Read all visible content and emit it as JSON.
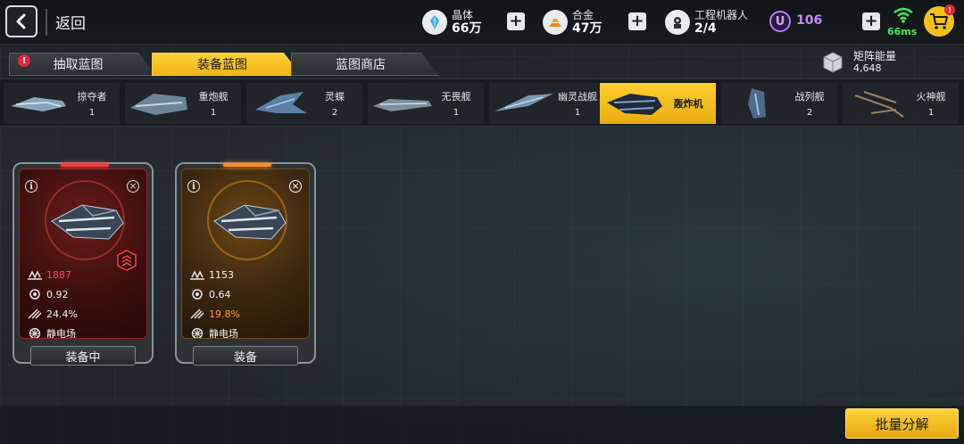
{
  "header": {
    "back_label": "返回",
    "resources": [
      {
        "label": "晶体",
        "value": "66万",
        "icon": "crystal-icon"
      },
      {
        "label": "合金",
        "value": "47万",
        "icon": "alloy-icon"
      },
      {
        "label": "工程机器人",
        "value": "2/4",
        "icon": "robot-icon"
      }
    ],
    "u_coin_symbol": "U",
    "u_coin_value": "106",
    "ping": "66ms",
    "cart_badge": "!"
  },
  "tabs": [
    {
      "label": "抽取蓝图",
      "active": false,
      "badge": "!"
    },
    {
      "label": "装备蓝图",
      "active": true
    },
    {
      "label": "蓝图商店",
      "active": false
    }
  ],
  "matrix": {
    "label": "矩阵能量",
    "value": "4,648"
  },
  "ship_types": [
    {
      "name": "掠夺者",
      "count": "1",
      "active": false
    },
    {
      "name": "重炮舰",
      "count": "1",
      "active": false
    },
    {
      "name": "灵蝶",
      "count": "2",
      "active": false
    },
    {
      "name": "无畏舰",
      "count": "1",
      "active": false
    },
    {
      "name": "幽灵战舰",
      "count": "1",
      "active": false
    },
    {
      "name": "轰炸机",
      "count": "",
      "active": true
    },
    {
      "name": "战列舰",
      "count": "2",
      "active": false
    },
    {
      "name": "火神舰",
      "count": "1",
      "active": false
    }
  ],
  "cards": [
    {
      "info": "i",
      "close": "×",
      "stats": {
        "power": "1887",
        "stat2": "0.92",
        "stat3": "24.4%",
        "skill": "静电场"
      },
      "button_label": "装备中",
      "rarity_color": "#ff3b3b"
    },
    {
      "info": "i",
      "close": "×",
      "stats": {
        "power": "1153",
        "stat2": "0.64",
        "stat3": "19.8%",
        "skill": "静电场"
      },
      "button_label": "装备",
      "rarity_color": "#ff8c1a"
    }
  ],
  "bottom": {
    "dismantle_label": "批量分解"
  }
}
